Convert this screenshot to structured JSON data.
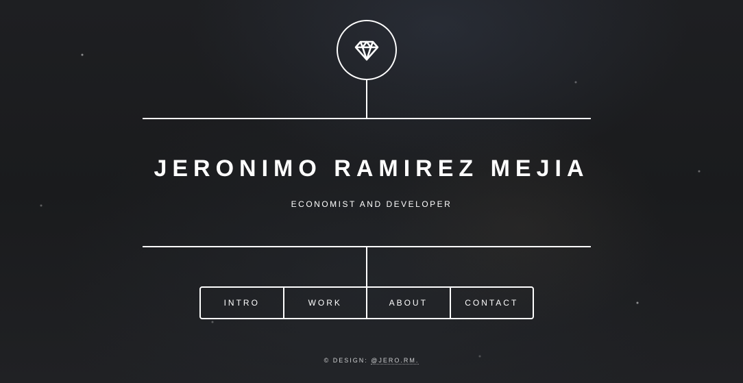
{
  "header": {
    "logo_icon": "diamond-icon"
  },
  "main": {
    "title": "JERONIMO RAMIREZ MEJIA",
    "subtitle": "ECONOMIST AND DEVELOPER"
  },
  "nav": {
    "items": [
      {
        "label": "INTRO"
      },
      {
        "label": "WORK"
      },
      {
        "label": "ABOUT"
      },
      {
        "label": "CONTACT"
      }
    ]
  },
  "footer": {
    "prefix": "© DESIGN: ",
    "link_label": "@JERO.RM."
  },
  "colors": {
    "background": "#1b1c1e",
    "foreground": "#ffffff"
  }
}
